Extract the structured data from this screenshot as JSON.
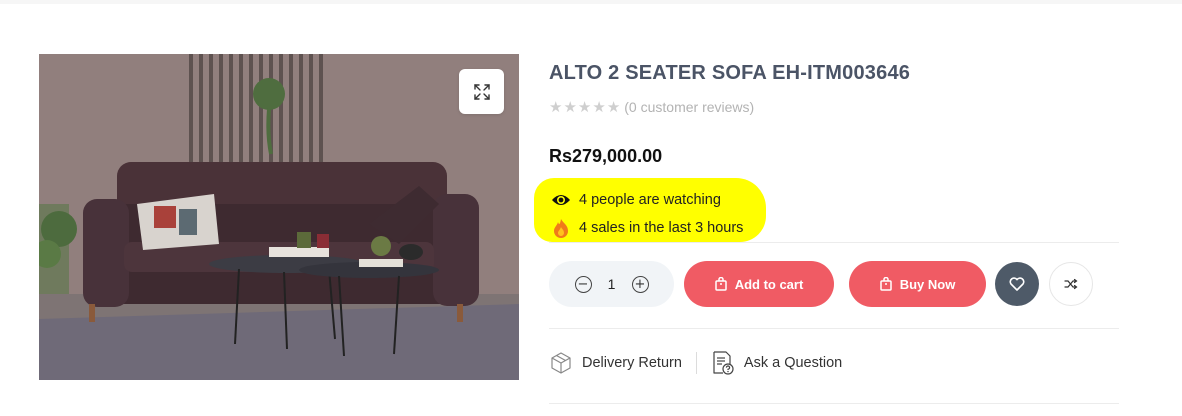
{
  "product": {
    "title": "ALTO 2 SEATER SOFA EH-ITM003646",
    "rating": {
      "stars_filled": 0,
      "stars_total": 5,
      "reviews_text": "(0 customer reviews)"
    },
    "price": "Rs279,000.00",
    "stats": {
      "watching": "4 people are watching",
      "sales": "4 sales in the last 3 hours"
    },
    "highlight_color": "#ffff00"
  },
  "purchase": {
    "quantity": "1",
    "add_to_cart_label": "Add to cart",
    "buy_now_label": "Buy Now",
    "button_color": "#f05b64",
    "wishlist_color": "#4e5a68"
  },
  "meta_links": {
    "delivery_label": "Delivery Return",
    "ask_label": "Ask a Question"
  },
  "icons": {
    "zoom": "expand-icon",
    "watching": "eye-icon",
    "sales": "fire-icon",
    "wishlist": "heart-icon",
    "compare": "shuffle-icon",
    "delivery": "box-icon",
    "ask": "question-doc-icon"
  }
}
